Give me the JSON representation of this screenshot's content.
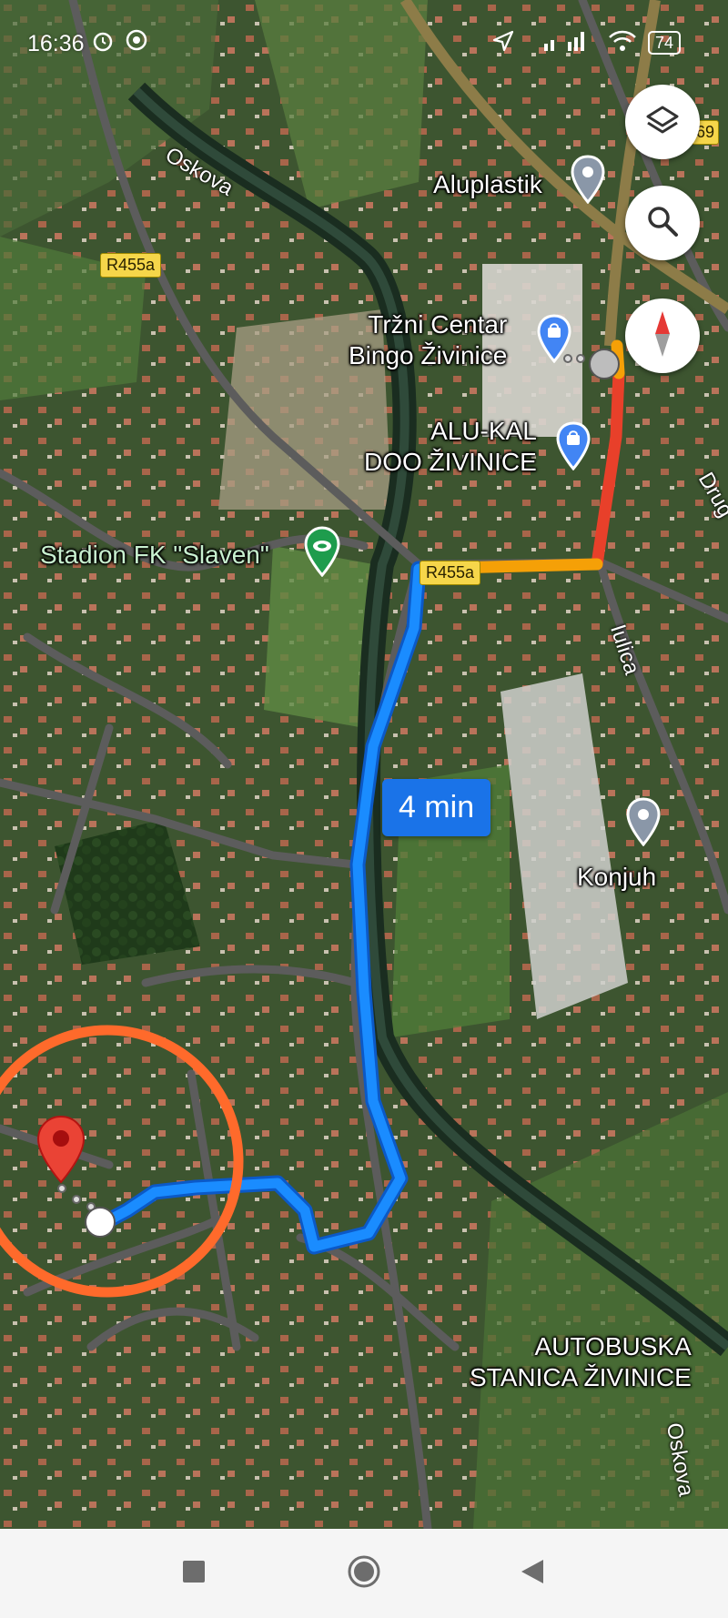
{
  "status_bar": {
    "time": "16:36",
    "battery": "74",
    "icons": [
      "alarm-icon",
      "chrome-icon",
      "location-arrow-icon",
      "signal-icon",
      "wifi-icon",
      "battery-icon"
    ]
  },
  "map": {
    "controls": [
      "layers-icon",
      "search-icon",
      "compass-icon"
    ],
    "route": {
      "eta": "4 min",
      "colors": {
        "route": "#1a8cff",
        "slow": "#f5a007",
        "heavy": "#e8402a"
      }
    },
    "places": [
      {
        "name": "Aluplastik",
        "icon": "place-pin-icon"
      },
      {
        "name_line1": "Tržni Centar",
        "name_line2": "Bingo Živinice",
        "icon": "shopping-bag-icon"
      },
      {
        "name_line1": "ALU-KAL",
        "name_line2": "DOO ŽIVINICE",
        "icon": "shopping-bag-icon"
      },
      {
        "name": "Stadion FK \"Slaven\"",
        "icon": "stadium-icon"
      },
      {
        "name": "Konjuh",
        "icon": "place-pin-icon"
      },
      {
        "name_line1": "AUTOBUSKA",
        "name_line2": "STANICA ŽIVINICE"
      }
    ],
    "road_badges": [
      "R455a",
      "R455a",
      "69"
    ],
    "streets": [
      "Oskova",
      "Iulica",
      "Drug",
      "Oskova"
    ],
    "destination": {
      "marker": "destination-pin-icon",
      "highlight_color": "#ff6a2b"
    }
  },
  "nav_bar": {
    "buttons": [
      "recents-square-icon",
      "home-circle-icon",
      "back-triangle-icon"
    ]
  }
}
